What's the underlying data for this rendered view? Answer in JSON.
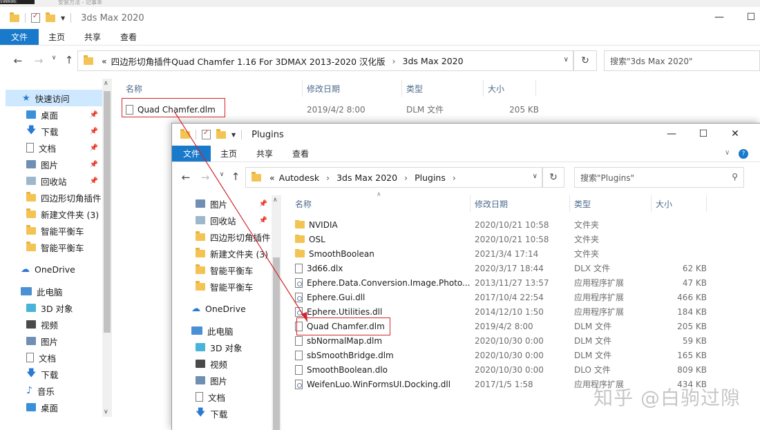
{
  "taskbar": {
    "left_label": "59869b:",
    "note_title": "安装方法 - 记事本"
  },
  "window1": {
    "title": "3ds Max 2020",
    "controls": {
      "minimize": "—",
      "maximize": "☐"
    },
    "ribbon": {
      "file": "文件",
      "home": "主页",
      "share": "共享",
      "view": "查看"
    },
    "address": {
      "prefix": "«",
      "parts": [
        "四边形切角插件Quad Chamfer 1.16 For 3DMAX 2013-2020 汉化版",
        "3ds Max 2020"
      ]
    },
    "search_placeholder": "搜索\"3ds Max 2020\"",
    "sidebar": {
      "quick_access": "快速访问",
      "items": [
        "桌面",
        "下载",
        "文档",
        "图片",
        "回收站",
        "四边形切角插件",
        "新建文件夹 (3)",
        "智能平衡车",
        "智能平衡车"
      ],
      "onedrive": "OneDrive",
      "this_pc": "此电脑",
      "pc_items": [
        "3D 对象",
        "视频",
        "图片",
        "文档",
        "下载",
        "音乐",
        "桌面"
      ]
    },
    "columns": {
      "name": "名称",
      "date": "修改日期",
      "type": "类型",
      "size": "大小"
    },
    "files": [
      {
        "name": "Quad Chamfer.dlm",
        "date": "2019/4/2 8:00",
        "type": "DLM 文件",
        "size": "205 KB"
      }
    ]
  },
  "window2": {
    "title": "Plugins",
    "controls": {
      "minimize": "—",
      "maximize": "☐",
      "close": "✕"
    },
    "ribbon": {
      "file": "文件",
      "home": "主页",
      "share": "共享",
      "view": "查看"
    },
    "address": {
      "prefix": "«",
      "parts": [
        "Autodesk",
        "3ds Max 2020",
        "Plugins"
      ]
    },
    "search_placeholder": "搜索\"Plugins\"",
    "sidebar": {
      "items": [
        "图片",
        "回收站",
        "四边形切角插件",
        "新建文件夹 (3)",
        "智能平衡车",
        "智能平衡车"
      ],
      "onedrive": "OneDrive",
      "this_pc": "此电脑",
      "pc_items": [
        "3D 对象",
        "视频",
        "图片",
        "文档",
        "下载"
      ]
    },
    "columns": {
      "name": "名称",
      "date": "修改日期",
      "type": "类型",
      "size": "大小"
    },
    "files": [
      {
        "name": "NVIDIA",
        "date": "2020/10/21 10:58",
        "type": "文件夹",
        "size": "",
        "kind": "folder"
      },
      {
        "name": "OSL",
        "date": "2020/10/21 10:58",
        "type": "文件夹",
        "size": "",
        "kind": "folder"
      },
      {
        "name": "SmoothBoolean",
        "date": "2021/3/4 17:14",
        "type": "文件夹",
        "size": "",
        "kind": "folder"
      },
      {
        "name": "3d66.dlx",
        "date": "2020/3/17 18:44",
        "type": "DLX 文件",
        "size": "62 KB",
        "kind": "file"
      },
      {
        "name": "Ephere.Data.Conversion.Image.Photo...",
        "date": "2013/11/27 13:57",
        "type": "应用程序扩展",
        "size": "47 KB",
        "kind": "dll"
      },
      {
        "name": "Ephere.Gui.dll",
        "date": "2017/10/4 22:54",
        "type": "应用程序扩展",
        "size": "466 KB",
        "kind": "dll"
      },
      {
        "name": "Ephere.Utilities.dll",
        "date": "2014/12/10 1:50",
        "type": "应用程序扩展",
        "size": "184 KB",
        "kind": "dll"
      },
      {
        "name": "Quad Chamfer.dlm",
        "date": "2019/4/2 8:00",
        "type": "DLM 文件",
        "size": "205 KB",
        "kind": "file"
      },
      {
        "name": "sbNormalMap.dlm",
        "date": "2020/10/30 0:00",
        "type": "DLM 文件",
        "size": "59 KB",
        "kind": "file"
      },
      {
        "name": "sbSmoothBridge.dlm",
        "date": "2020/10/30 0:00",
        "type": "DLM 文件",
        "size": "165 KB",
        "kind": "file"
      },
      {
        "name": "SmoothBoolean.dlo",
        "date": "2020/10/30 0:00",
        "type": "DLO 文件",
        "size": "809 KB",
        "kind": "file"
      },
      {
        "name": "WeifenLuo.WinFormsUI.Docking.dll",
        "date": "2017/1/5 1:58",
        "type": "应用程序扩展",
        "size": "434 KB",
        "kind": "dll"
      }
    ]
  },
  "watermark": "知乎 @白驹过隙",
  "colors": {
    "accent": "#1979ca",
    "highlight_box": "#d4232a",
    "arrow": "#d4232a"
  }
}
